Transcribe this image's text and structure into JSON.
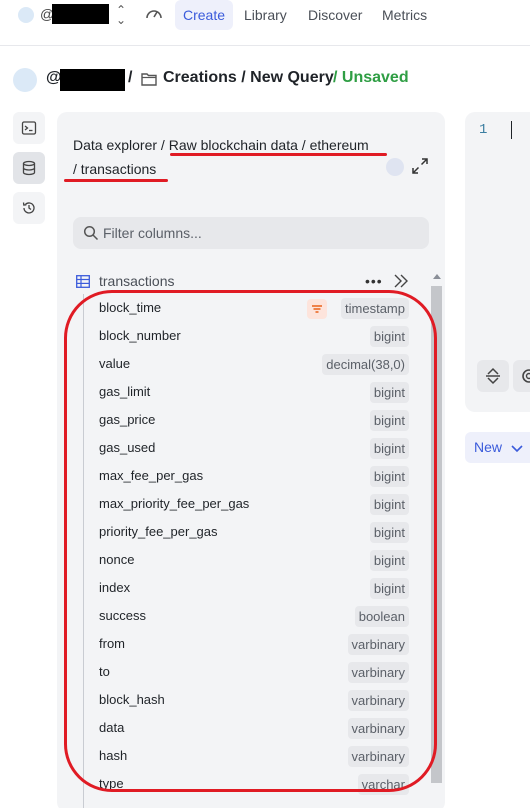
{
  "topnav": {
    "at_symbol": "@",
    "tabs": [
      {
        "label": "Create",
        "active": true
      },
      {
        "label": "Library",
        "active": false
      },
      {
        "label": "Discover",
        "active": false
      },
      {
        "label": "Metrics",
        "active": false
      }
    ]
  },
  "header": {
    "at_symbol": "@",
    "slash": "/",
    "path": "Creations / New Query",
    "status": "/ Unsaved"
  },
  "explorer": {
    "path_line1": "Data explorer / Raw blockchain data / ethereum",
    "path_line2": "/ transactions",
    "filter_placeholder": "Filter columns...",
    "table_name": "transactions",
    "more_label": "•••",
    "columns": [
      {
        "name": "block_time",
        "type": "timestamp",
        "sorted": true
      },
      {
        "name": "block_number",
        "type": "bigint"
      },
      {
        "name": "value",
        "type": "decimal(38,0)"
      },
      {
        "name": "gas_limit",
        "type": "bigint"
      },
      {
        "name": "gas_price",
        "type": "bigint"
      },
      {
        "name": "gas_used",
        "type": "bigint"
      },
      {
        "name": "max_fee_per_gas",
        "type": "bigint"
      },
      {
        "name": "max_priority_fee_per_gas",
        "type": "bigint"
      },
      {
        "name": "priority_fee_per_gas",
        "type": "bigint"
      },
      {
        "name": "nonce",
        "type": "bigint"
      },
      {
        "name": "index",
        "type": "bigint"
      },
      {
        "name": "success",
        "type": "boolean"
      },
      {
        "name": "from",
        "type": "varbinary"
      },
      {
        "name": "to",
        "type": "varbinary"
      },
      {
        "name": "block_hash",
        "type": "varbinary"
      },
      {
        "name": "data",
        "type": "varbinary"
      },
      {
        "name": "hash",
        "type": "varbinary"
      },
      {
        "name": "type",
        "type": "varchar"
      }
    ]
  },
  "editor": {
    "line_number": "1",
    "new_button_label": "New"
  },
  "colors": {
    "accent": "#3b5bdb",
    "unsaved_green": "#2f9e44",
    "annotation_red": "#e01b24",
    "panel_bg": "#f3f4f6"
  },
  "icons": [
    "terminal-icon",
    "database-icon",
    "history-icon",
    "gauge-icon",
    "folder-icon",
    "expand-icon",
    "search-icon",
    "table-icon",
    "collapse-icon",
    "sort-icon",
    "swap-icon",
    "settings-icon",
    "chevron-down-icon"
  ]
}
